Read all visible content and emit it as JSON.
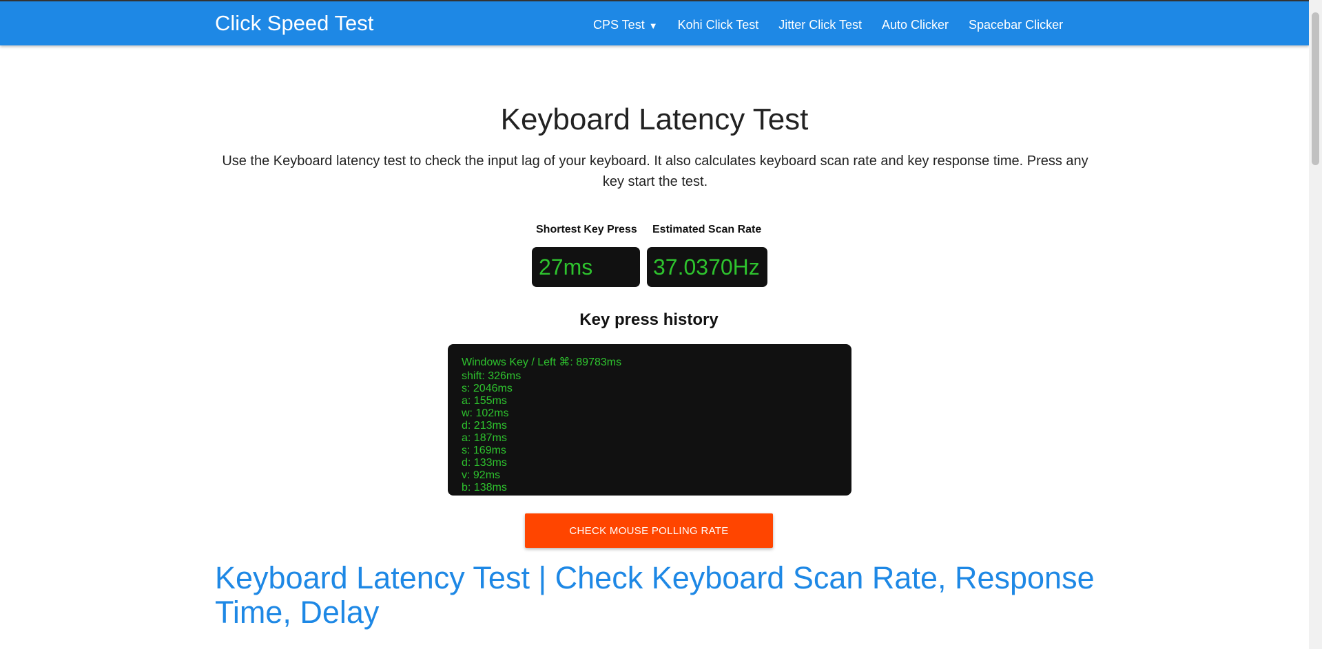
{
  "header": {
    "brand": "Click Speed Test",
    "nav": [
      {
        "label": "CPS Test",
        "has_dropdown": true,
        "caret": "▼"
      },
      {
        "label": "Kohi Click Test"
      },
      {
        "label": "Jitter Click Test"
      },
      {
        "label": "Auto Clicker"
      },
      {
        "label": "Spacebar Clicker"
      }
    ]
  },
  "main": {
    "title": "Keyboard Latency Test",
    "intro": "Use the Keyboard latency test to check the input lag of your keyboard. It also calculates keyboard scan rate and key response time. Press any key start the test.",
    "stats": {
      "shortest_label": "Shortest Key Press",
      "shortest_value": "27ms",
      "scan_label": "Estimated Scan Rate",
      "scan_value": "37.0370Hz"
    },
    "history_title": "Key press history",
    "history": [
      "Windows Key / Left ⌘: 89783ms",
      "shift: 326ms",
      "s: 2046ms",
      "a: 155ms",
      "w: 102ms",
      "d: 213ms",
      "a: 187ms",
      "s: 169ms",
      "d: 133ms",
      "v: 92ms",
      "b: 138ms"
    ],
    "cta_label": "CHECK MOUSE POLLING RATE",
    "section_title": "Keyboard Latency Test | Check Keyboard Scan Rate, Response Time, Delay"
  },
  "colors": {
    "header_bg": "#1e88e5",
    "stat_text": "#2ec32e",
    "box_bg": "#111111",
    "cta_bg": "#ff4500",
    "link_heading": "#1e88e5"
  }
}
